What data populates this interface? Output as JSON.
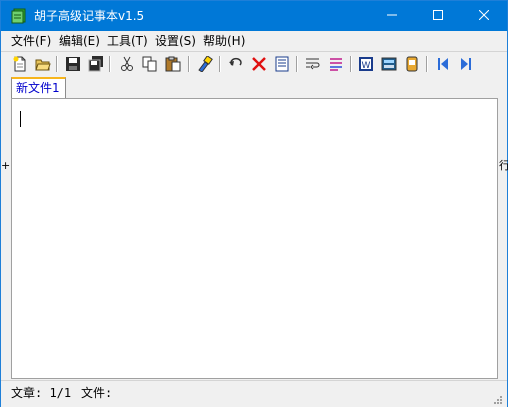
{
  "window": {
    "title": "胡子高级记事本v1.5"
  },
  "titlebar": {
    "controls": [
      {
        "name": "minimize-button",
        "icon": "minimize-icon"
      },
      {
        "name": "maximize-button",
        "icon": "maximize-icon"
      },
      {
        "name": "close-button",
        "icon": "close-icon"
      }
    ]
  },
  "menu": {
    "items": [
      {
        "label": "文件(F)"
      },
      {
        "label": "编辑(E)"
      },
      {
        "label": "工具(T)"
      },
      {
        "label": "设置(S)"
      },
      {
        "label": "帮助(H)"
      }
    ]
  },
  "toolbar": {
    "icons": [
      "new-file-icon",
      "open-folder-icon",
      "save-icon",
      "save-all-icon",
      "cut-icon",
      "copy-icon",
      "paste-icon",
      "format-brush-icon",
      "undo-icon",
      "delete-icon",
      "document-icon",
      "word-wrap-icon",
      "line-list-icon",
      "word-doc-icon",
      "calculator-icon",
      "notes-icon",
      "first-icon",
      "last-icon"
    ]
  },
  "tabs": [
    {
      "label": "新文件1",
      "active": true
    }
  ],
  "editor": {
    "content": ""
  },
  "side": {
    "left": "+",
    "right": "行"
  },
  "status": {
    "article": "文章: 1/1",
    "file": "文件:"
  },
  "colors": {
    "titlebar": "#0078d7",
    "tab_accent": "#f7b51c",
    "tab_text": "#0000cc"
  }
}
